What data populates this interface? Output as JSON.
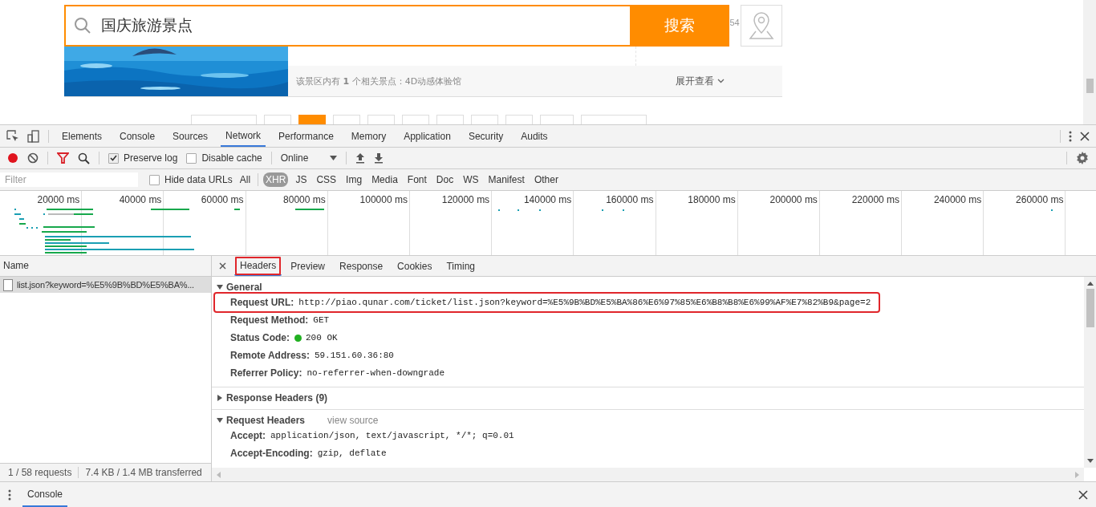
{
  "page": {
    "search": {
      "value": "国庆旅游景点",
      "button": "搜索"
    },
    "side_text": "54",
    "info_text": "该景区内有 **1** 个相关景点：4D动感体验馆",
    "expand_link": "展开查看",
    "pagination": [
      {
        "kind": "wide",
        "selected": false
      },
      {
        "kind": "number",
        "selected": false
      },
      {
        "kind": "number",
        "selected": true
      },
      {
        "kind": "number",
        "selected": false
      },
      {
        "kind": "number",
        "selected": false
      },
      {
        "kind": "number",
        "selected": false
      },
      {
        "kind": "number",
        "selected": false
      },
      {
        "kind": "number",
        "selected": false
      },
      {
        "kind": "number",
        "selected": false
      },
      {
        "kind": "gap",
        "selected": false
      },
      {
        "kind": "wide",
        "selected": false
      }
    ]
  },
  "devtools": {
    "tabs": [
      {
        "label": "Elements",
        "selected": false
      },
      {
        "label": "Console",
        "selected": false
      },
      {
        "label": "Sources",
        "selected": false
      },
      {
        "label": "Network",
        "selected": true
      },
      {
        "label": "Performance",
        "selected": false
      },
      {
        "label": "Memory",
        "selected": false
      },
      {
        "label": "Application",
        "selected": false
      },
      {
        "label": "Security",
        "selected": false
      },
      {
        "label": "Audits",
        "selected": false
      }
    ],
    "toolbar": {
      "recording": true,
      "preserve_log": {
        "label": "Preserve log",
        "checked": true
      },
      "disable_cache": {
        "label": "Disable cache",
        "checked": false
      },
      "throttling": "Online"
    },
    "filter": {
      "placeholder": "Filter",
      "hide_data_urls": {
        "label": "Hide data URLs",
        "checked": false
      },
      "types": [
        {
          "label": "All",
          "selected": false
        },
        {
          "label": "XHR",
          "selected": true
        },
        {
          "label": "JS",
          "selected": false
        },
        {
          "label": "CSS",
          "selected": false
        },
        {
          "label": "Img",
          "selected": false
        },
        {
          "label": "Media",
          "selected": false
        },
        {
          "label": "Font",
          "selected": false
        },
        {
          "label": "Doc",
          "selected": false
        },
        {
          "label": "WS",
          "selected": false
        },
        {
          "label": "Manifest",
          "selected": false
        },
        {
          "label": "Other",
          "selected": false
        }
      ]
    },
    "overview_ticks": [
      "20000 ms",
      "40000 ms",
      "60000 ms",
      "80000 ms",
      "100000 ms",
      "120000 ms",
      "140000 ms",
      "160000 ms",
      "180000 ms",
      "200000 ms",
      "220000 ms",
      "240000 ms",
      "260000 ms"
    ],
    "requests": {
      "header": "Name",
      "rows": [
        {
          "name": "list.json?keyword=%E5%9B%BD%E5%BA%...",
          "selected": true
        }
      ],
      "summary": [
        "1 / 58 requests",
        "7.4 KB / 1.4 MB transferred"
      ]
    },
    "detail_tabs": [
      {
        "label": "Headers",
        "selected": true,
        "highlighted": true
      },
      {
        "label": "Preview",
        "selected": false,
        "highlighted": false
      },
      {
        "label": "Response",
        "selected": false,
        "highlighted": false
      },
      {
        "label": "Cookies",
        "selected": false,
        "highlighted": false
      },
      {
        "label": "Timing",
        "selected": false,
        "highlighted": false
      }
    ],
    "sections": [
      {
        "title": "General",
        "expanded": true,
        "rows": [
          {
            "key": "Request URL:",
            "value": "http://piao.qunar.com/ticket/list.json?keyword=%E5%9B%BD%E5%BA%86%E6%97%85%E6%B8%B8%E6%99%AF%E7%82%B9&page=2",
            "highlighted": true
          },
          {
            "key": "Request Method:",
            "value": "GET",
            "highlighted": false
          },
          {
            "key": "Status Code:",
            "value": "200 OK",
            "highlighted": false,
            "color": "#21b021"
          },
          {
            "key": "Remote Address:",
            "value": "59.151.60.36:80",
            "highlighted": false
          },
          {
            "key": "Referrer Policy:",
            "value": "no-referrer-when-downgrade",
            "highlighted": false
          }
        ]
      },
      {
        "title": "Response Headers (9)",
        "expanded": false
      },
      {
        "title": "Request Headers",
        "expanded": true,
        "link": "view source",
        "rows": [
          {
            "key": "Accept:",
            "value": "application/json, text/javascript, */*; q=0.01",
            "highlighted": false
          },
          {
            "key": "Accept-Encoding:",
            "value": "gzip, deflate",
            "highlighted": false
          }
        ]
      }
    ],
    "drawer": {
      "tabs": [
        {
          "label": "Console",
          "selected": true
        }
      ]
    }
  }
}
